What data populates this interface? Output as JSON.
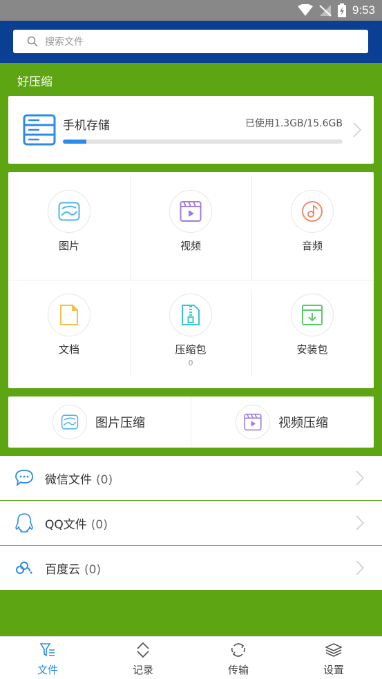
{
  "status_bar": {
    "time": "9:53"
  },
  "search": {
    "placeholder": "搜索文件"
  },
  "app_title": "好压缩",
  "storage": {
    "label": "手机存储",
    "usage_text": "已使用1.3GB/15.6GB",
    "used_fraction": 0.083
  },
  "categories": [
    {
      "label": "图片",
      "icon": "image-icon",
      "color": "#4db6e8"
    },
    {
      "label": "视频",
      "icon": "video-icon",
      "color": "#a07be0"
    },
    {
      "label": "音频",
      "icon": "music-icon",
      "color": "#f08a6a"
    },
    {
      "label": "文档",
      "icon": "document-icon",
      "color": "#f5c04a"
    },
    {
      "label": "压缩包",
      "icon": "archive-icon",
      "color": "#3ec2d8",
      "count": "0"
    },
    {
      "label": "安装包",
      "icon": "package-icon",
      "color": "#5cc96a"
    }
  ],
  "compress": [
    {
      "label": "图片压缩",
      "icon": "image-icon"
    },
    {
      "label": "视频压缩",
      "icon": "video-icon"
    }
  ],
  "sources": [
    {
      "label": "微信文件",
      "count": "(0)",
      "icon": "wechat-icon"
    },
    {
      "label": "QQ文件",
      "count": "(0)",
      "icon": "qq-icon"
    },
    {
      "label": "百度云",
      "count": "(0)",
      "icon": "baidu-cloud-icon"
    }
  ],
  "nav": [
    {
      "label": "文件",
      "icon": "file-filter-icon",
      "active": true
    },
    {
      "label": "记录",
      "icon": "record-icon",
      "active": false
    },
    {
      "label": "传输",
      "icon": "transfer-icon",
      "active": false
    },
    {
      "label": "设置",
      "icon": "settings-layers-icon",
      "active": false
    }
  ],
  "colors": {
    "accent": "#2b8be6",
    "background": "#5ea514",
    "header": "#0a3f94"
  }
}
